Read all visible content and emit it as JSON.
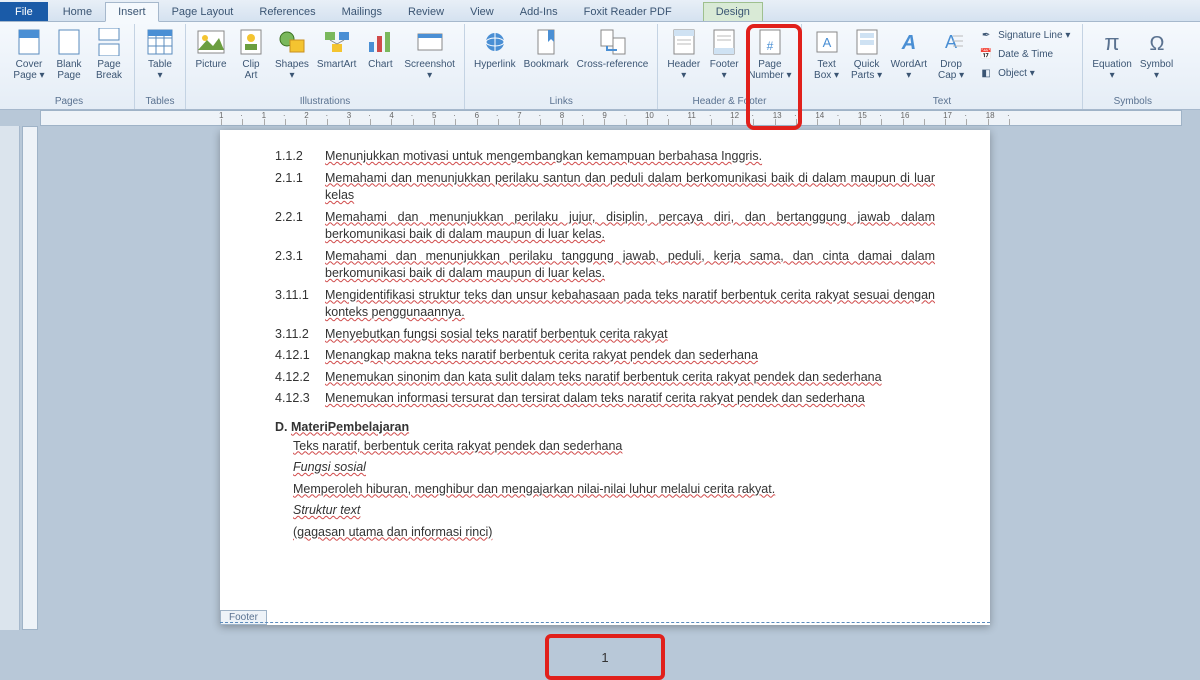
{
  "tabs": {
    "file": "File",
    "home": "Home",
    "insert": "Insert",
    "pageLayout": "Page Layout",
    "references": "References",
    "mailings": "Mailings",
    "review": "Review",
    "view": "View",
    "addins": "Add-Ins",
    "foxit": "Foxit Reader PDF",
    "design": "Design"
  },
  "groups": {
    "pages": "Pages",
    "tables": "Tables",
    "illustrations": "Illustrations",
    "links": "Links",
    "headerFooter": "Header & Footer",
    "text": "Text",
    "symbols": "Symbols"
  },
  "btn": {
    "coverPage": "Cover\nPage ▾",
    "blankPage": "Blank\nPage",
    "pageBreak": "Page\nBreak",
    "table": "Table\n▾",
    "picture": "Picture",
    "clipArt": "Clip\nArt",
    "shapes": "Shapes\n▾",
    "smartArt": "SmartArt",
    "chart": "Chart",
    "screenshot": "Screenshot\n▾",
    "hyperlink": "Hyperlink",
    "bookmark": "Bookmark",
    "crossRef": "Cross-reference",
    "header": "Header\n▾",
    "footer": "Footer\n▾",
    "pageNumber": "Page\nNumber ▾",
    "textBox": "Text\nBox ▾",
    "quickParts": "Quick\nParts ▾",
    "wordArt": "WordArt\n▾",
    "dropCap": "Drop\nCap ▾",
    "sigLine": "Signature Line ▾",
    "dateTime": "Date & Time",
    "object": "Object ▾",
    "equation": "Equation\n▾",
    "symbol": "Symbol\n▾"
  },
  "ruler": [
    "1",
    "·",
    "1",
    "·",
    "2",
    "·",
    "3",
    "·",
    "4",
    "·",
    "5",
    "·",
    "6",
    "·",
    "7",
    "·",
    "8",
    "·",
    "9",
    "·",
    "10",
    "·",
    "11",
    "·",
    "12",
    "·",
    "13",
    "·",
    "14",
    "·",
    "15",
    "·",
    "16",
    "",
    "17",
    "·",
    "18",
    "·"
  ],
  "doc": {
    "lines": [
      {
        "n": "1.1.2",
        "t": "Menunjukkan motivasi untuk mengembangkan kemampuan berbahasa Inggris."
      },
      {
        "n": "2.1.1",
        "t": "Memahami dan menunjukkan perilaku santun dan peduli dalam berkomunikasi baik di dalam maupun di luar kelas"
      },
      {
        "n": "2.2.1",
        "t": "Memahami dan menunjukkan perilaku jujur, disiplin, percaya diri, dan bertanggung jawab dalam berkomunikasi baik di dalam maupun di luar kelas."
      },
      {
        "n": "2.3.1",
        "t": "Memahami dan menunjukkan perilaku tanggung jawab, peduli, kerja sama, dan cinta damai dalam berkomunikasi baik di dalam maupun di luar kelas."
      },
      {
        "n": "3.11.1",
        "t": "Mengidentifikasi struktur teks dan unsur kebahasaan pada teks naratif  berbentuk cerita rakyat sesuai dengan konteks penggunaannya."
      },
      {
        "n": "3.11.2",
        "t": "Menyebutkan  fungsi sosial teks naratif berbentuk cerita rakyat"
      },
      {
        "n": "4.12.1",
        "t": "Menangkap makna teks naratif berbentuk cerita rakyat pendek dan sederhana"
      },
      {
        "n": "4.12.2",
        "t": "Menemukan sinonim dan kata sulit dalam teks naratif berbentuk cerita rakyat pendek dan sederhana"
      },
      {
        "n": "4.12.3",
        "t": "Menemukan  informasi tersurat dan tersirat dalam teks naratif cerita rakyat pendek dan sederhana"
      }
    ],
    "sectionLetter": "D.",
    "sectionTitle": "MateriPembelajaran",
    "p1": "Teks naratif, berbentuk cerita rakyat pendek dan sederhana",
    "p2": "Fungsi sosial",
    "p3": "Memperoleh hiburan, menghibur dan mengajarkan nilai-nilai luhur melalui cerita rakyat.",
    "p4": "Struktur text",
    "p5": "(gagasan utama dan informasi rinci)"
  },
  "footer": {
    "label": "Footer",
    "pageNumber": "1"
  }
}
